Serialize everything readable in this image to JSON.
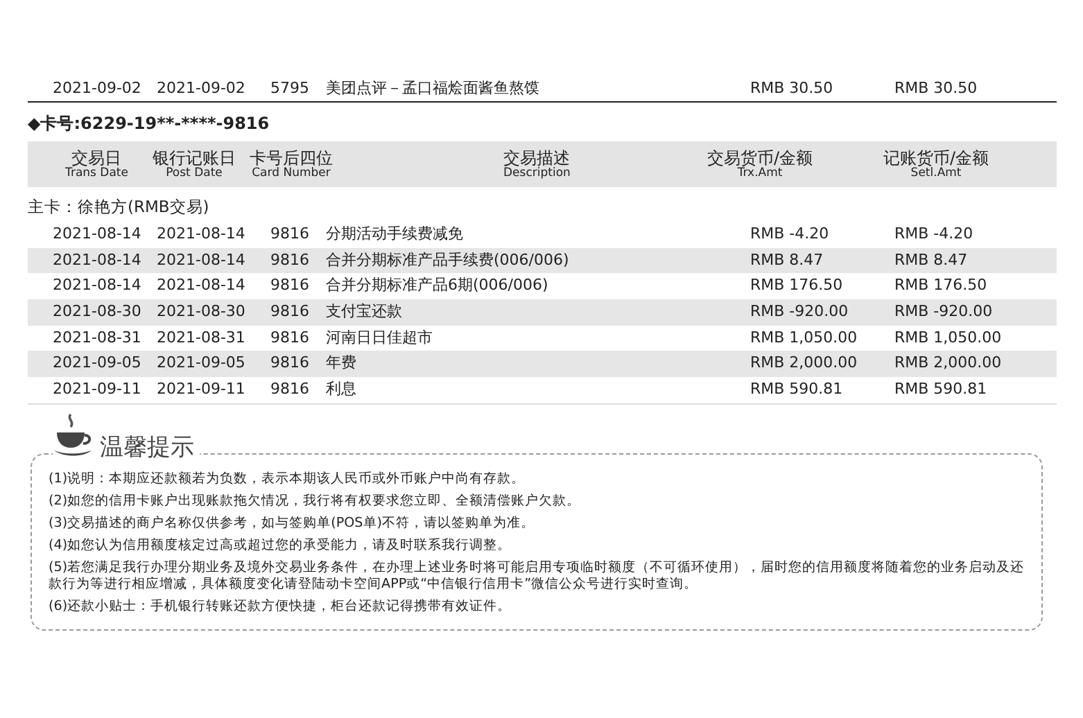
{
  "previous_rows": [
    {
      "trans_date": "2021-09-02",
      "post_date": "2021-09-02",
      "card_number": "5795",
      "description": "美团点评－孟口福烩面酱鱼熬馍",
      "trx_amt": "RMB 30.50",
      "settl_amt": "RMB 30.50"
    }
  ],
  "card_header": "◆卡号:6229-19**-****-9816",
  "columns": [
    {
      "zh": "交易日",
      "en": "Trans Date"
    },
    {
      "zh": "银行记账日",
      "en": "Post Date"
    },
    {
      "zh": "卡号后四位",
      "en": "Card Number"
    },
    {
      "zh": "交易描述",
      "en": "Description"
    },
    {
      "zh": "交易货币/金额",
      "en": "Trx.Amt"
    },
    {
      "zh": "记账货币/金额",
      "en": "Setl.Amt"
    }
  ],
  "cardholder": "主卡：徐艳方(RMB交易)",
  "rows": [
    {
      "trans_date": "2021-08-14",
      "post_date": "2021-08-14",
      "card_number": "9816",
      "description": "分期活动手续费减免",
      "trx_amt": "RMB -4.20",
      "settl_amt": "RMB -4.20"
    },
    {
      "trans_date": "2021-08-14",
      "post_date": "2021-08-14",
      "card_number": "9816",
      "description": "合并分期标准产品手续费(006/006)",
      "trx_amt": "RMB 8.47",
      "settl_amt": "RMB 8.47"
    },
    {
      "trans_date": "2021-08-14",
      "post_date": "2021-08-14",
      "card_number": "9816",
      "description": "合并分期标准产品6期(006/006)",
      "trx_amt": "RMB 176.50",
      "settl_amt": "RMB 176.50"
    },
    {
      "trans_date": "2021-08-30",
      "post_date": "2021-08-30",
      "card_number": "9816",
      "description": "支付宝还款",
      "trx_amt": "RMB -920.00",
      "settl_amt": "RMB -920.00"
    },
    {
      "trans_date": "2021-08-31",
      "post_date": "2021-08-31",
      "card_number": "9816",
      "description": "河南日日佳超市",
      "trx_amt": "RMB 1,050.00",
      "settl_amt": "RMB 1,050.00"
    },
    {
      "trans_date": "2021-09-05",
      "post_date": "2021-09-05",
      "card_number": "9816",
      "description": "年费",
      "trx_amt": "RMB 2,000.00",
      "settl_amt": "RMB 2,000.00"
    },
    {
      "trans_date": "2021-09-11",
      "post_date": "2021-09-11",
      "card_number": "9816",
      "description": "利息",
      "trx_amt": "RMB 590.81",
      "settl_amt": "RMB 590.81"
    }
  ],
  "tips": {
    "title": "温馨提示",
    "items": [
      "(1)说明：本期应还款额若为负数，表示本期该人民币或外币账户中尚有存款。",
      "(2)如您的信用卡账户出现账款拖欠情况，我行将有权要求您立即、全额清偿账户欠款。",
      "(3)交易描述的商户名称仅供参考，如与签购单(POS单)不符，请以签购单为准。",
      "(4)如您认为信用额度核定过高或超过您的承受能力，请及时联系我行调整。",
      "(5)若您满足我行办理分期业务及境外交易业务条件，在办理上述业务时将可能启用专项临时额度（不可循环使用），届时您的信用额度将随着您的业务启动及还款行为等进行相应增减，具体额度变化请登陆动卡空间APP或“中信银行信用卡”微信公众号进行实时查询。",
      "(6)还款小贴士：手机银行转账还款方便快捷，柜台还款记得携带有效证件。"
    ]
  }
}
